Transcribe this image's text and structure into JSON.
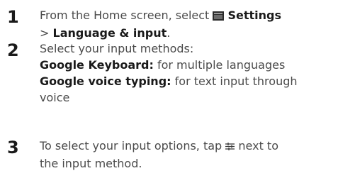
{
  "steps": [
    {
      "number": "1",
      "line1_prefix": "From the Home screen, select",
      "settings_label": "Settings",
      "line2_separator": ">",
      "language_input_label": "Language & input",
      "line2_suffix": "."
    },
    {
      "number": "2",
      "intro": "Select your input methods:",
      "keyboard_label": "Google Keyboard:",
      "keyboard_desc": "for multiple languages",
      "voice_label": "Google voice typing:",
      "voice_desc": "for text input through",
      "voice_desc_cont": "voice"
    },
    {
      "number": "3",
      "line1_prefix": "To select your input options, tap",
      "line1_suffix": "next to",
      "line2": "the input method."
    }
  ],
  "icons": {
    "settings": "settings-icon",
    "options": "input-options-icon"
  }
}
